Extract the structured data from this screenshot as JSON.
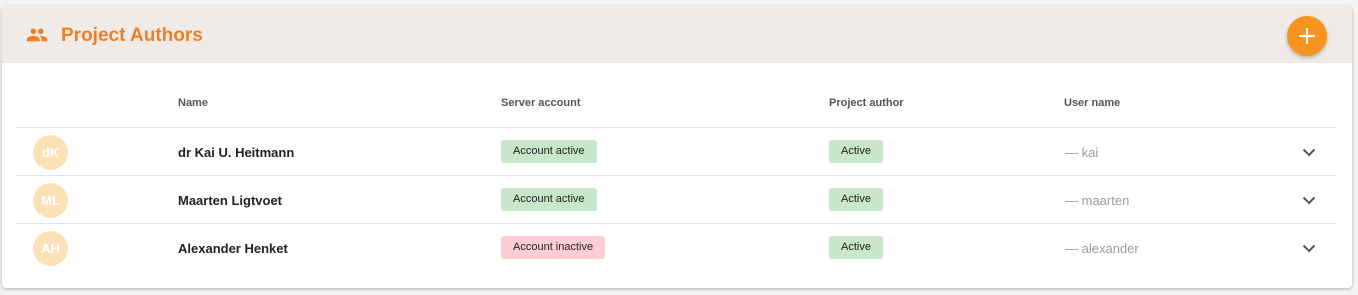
{
  "header": {
    "title": "Project Authors"
  },
  "columns": {
    "name": "Name",
    "server_account": "Server account",
    "project_author": "Project author",
    "user_name": "User name"
  },
  "rows": [
    {
      "initials": "dK",
      "name": "dr Kai U. Heitmann",
      "server_account": "Account active",
      "server_status": "active",
      "project_author": "Active",
      "user_name": "— kai"
    },
    {
      "initials": "ML",
      "name": "Maarten Ligtvoet",
      "server_account": "Account active",
      "server_status": "active",
      "project_author": "Active",
      "user_name": "— maarten"
    },
    {
      "initials": "AH",
      "name": "Alexander Henket",
      "server_account": "Account inactive",
      "server_status": "inactive",
      "project_author": "Active",
      "user_name": "— alexander"
    }
  ],
  "icons": {
    "header": "people-icon",
    "add": "plus-icon",
    "expand": "chevron-down-icon"
  },
  "colors": {
    "accent": "#f07f24",
    "fab": "#f7931e",
    "header_bg": "#f0ebe6",
    "avatar_bg": "#fde1b6",
    "chip_active": "#c8e6c9",
    "chip_inactive": "#ffcdd2"
  }
}
